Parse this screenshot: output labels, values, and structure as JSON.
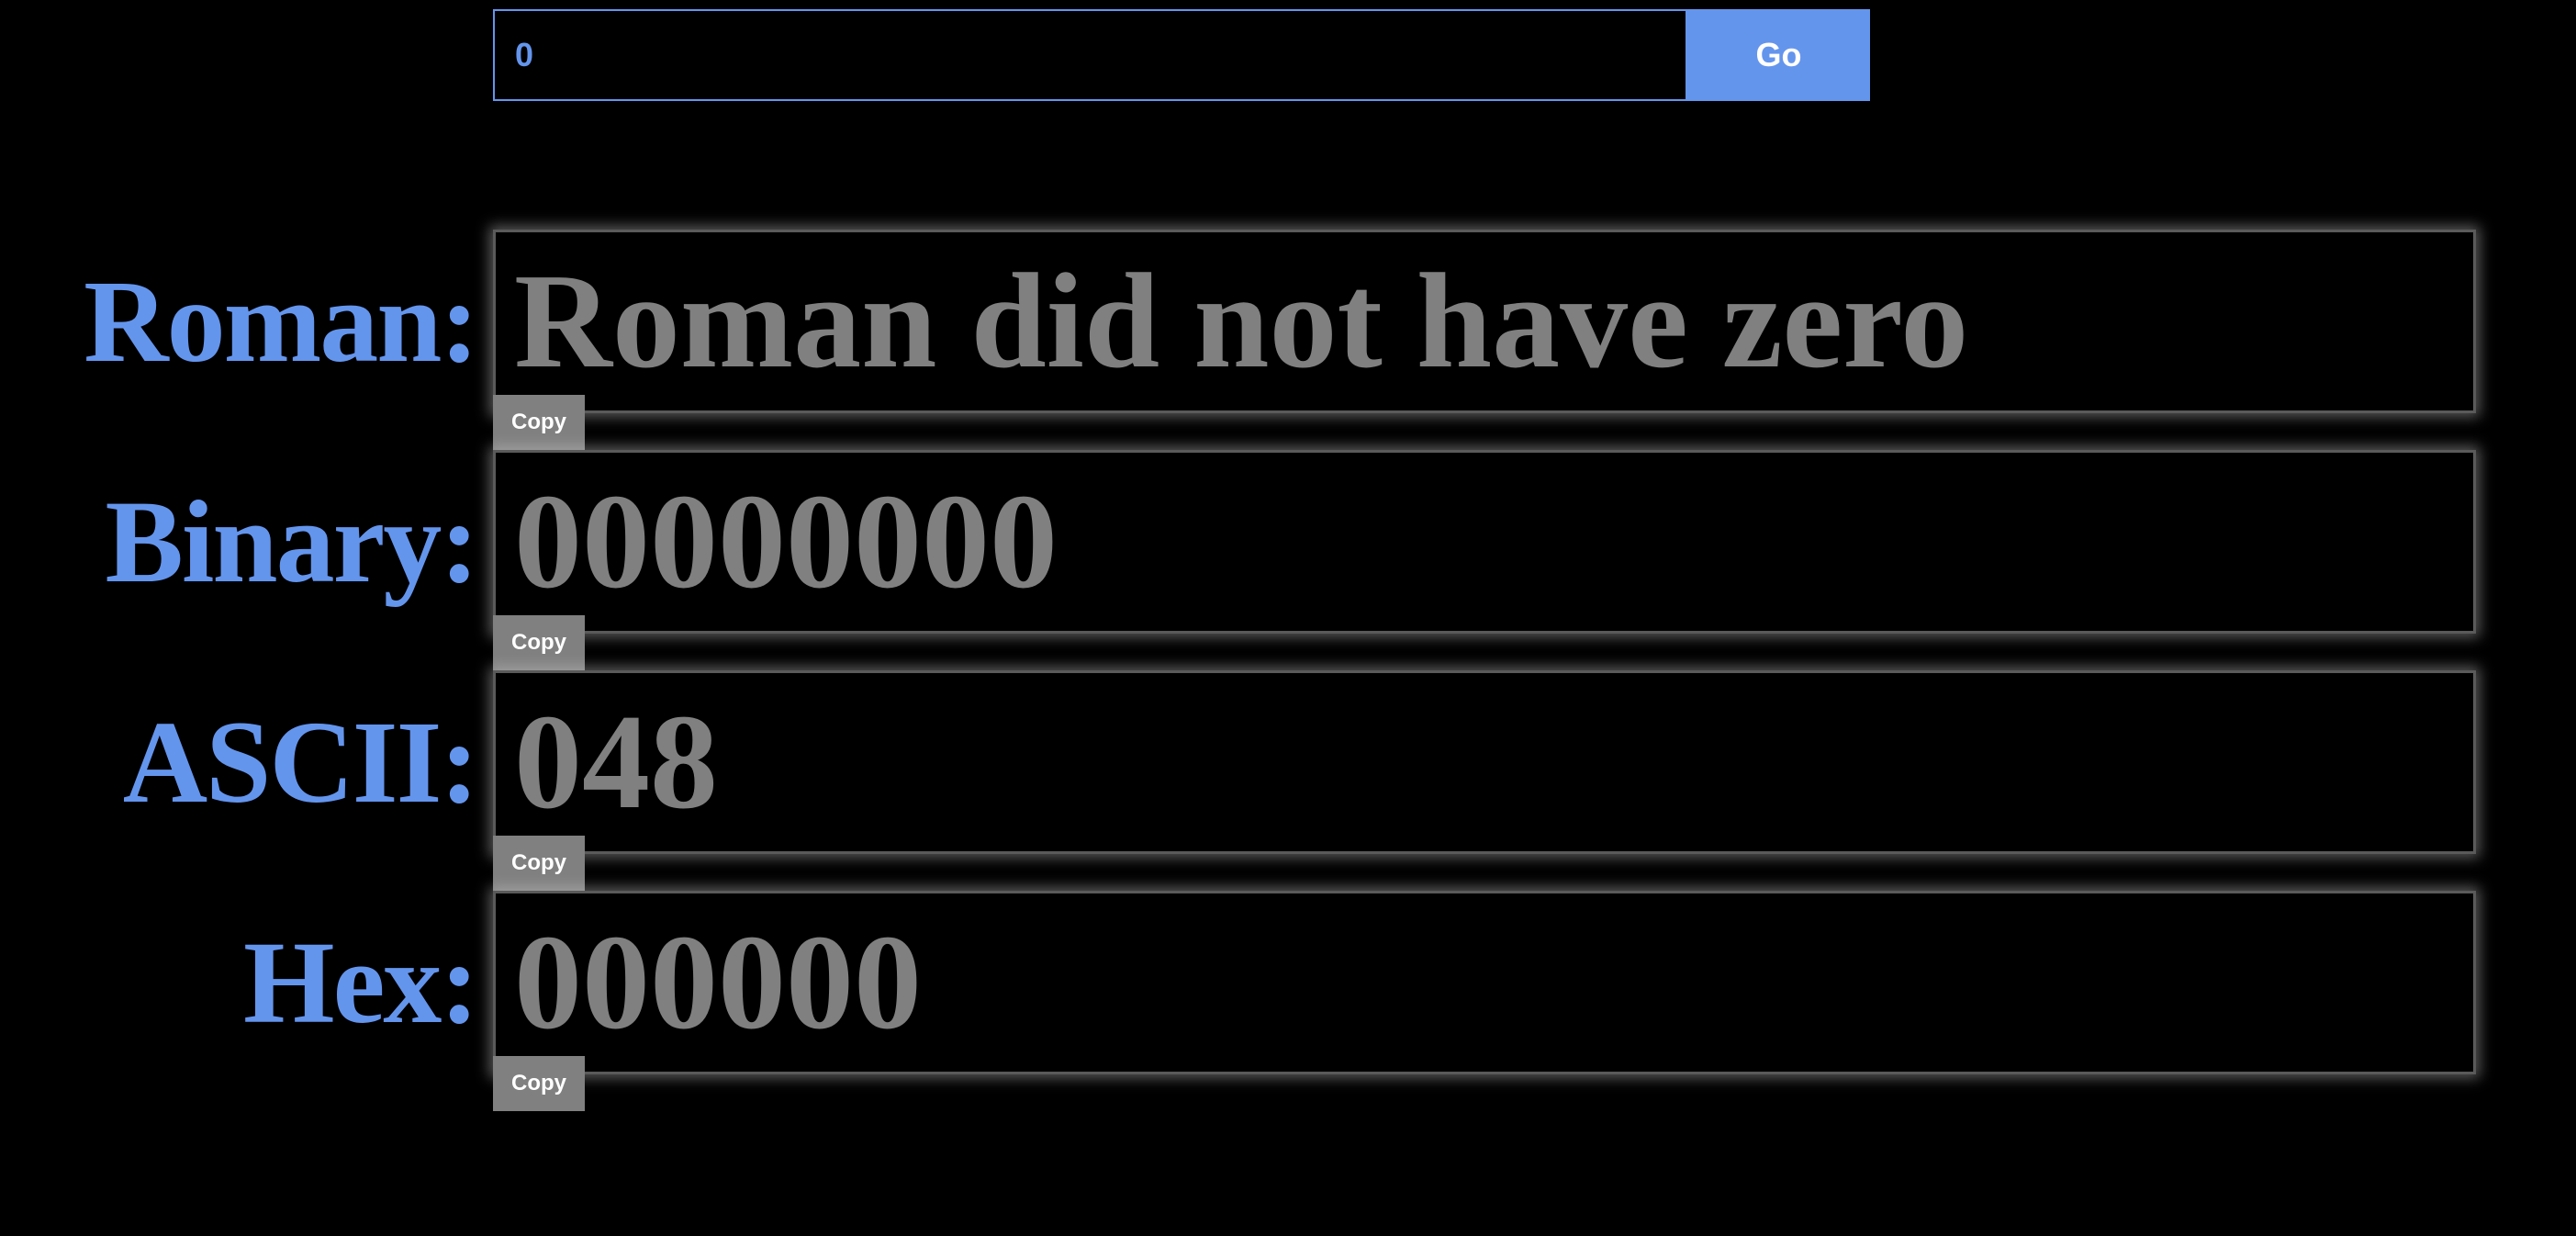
{
  "search": {
    "value": "0",
    "go_label": "Go"
  },
  "rows": [
    {
      "label": "Roman:",
      "value": "Roman did not have zero",
      "copy_label": "Copy"
    },
    {
      "label": "Binary:",
      "value": "00000000",
      "copy_label": "Copy"
    },
    {
      "label": "ASCII:",
      "value": "048",
      "copy_label": "Copy"
    },
    {
      "label": "Hex:",
      "value": "000000",
      "copy_label": "Copy"
    }
  ],
  "colors": {
    "background": "#000000",
    "accent": "#6495ED",
    "output_text": "#808080",
    "copy_button": "#808080"
  }
}
